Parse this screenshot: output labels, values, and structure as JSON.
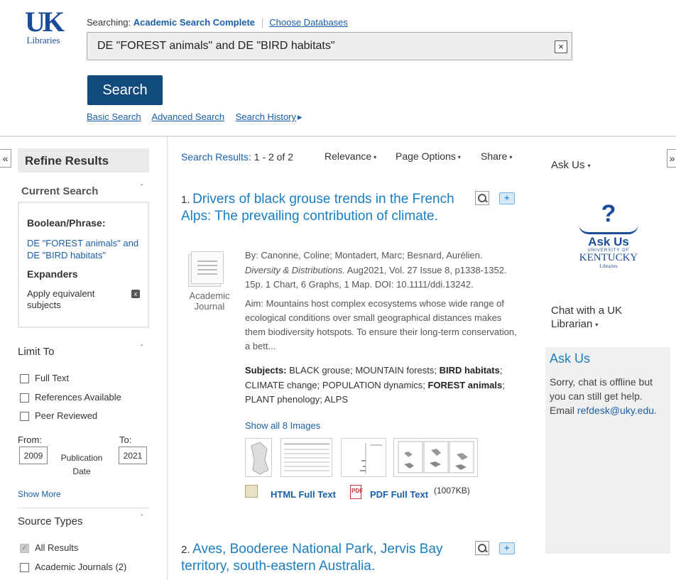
{
  "header": {
    "logo_uk": "UK",
    "logo_libraries": "Libraries",
    "searching_label": "Searching:",
    "database": "Academic Search Complete",
    "choose_databases": "Choose Databases",
    "search_value": "DE \"FOREST animals\" and DE \"BIRD habitats\"",
    "clear_label": "×",
    "search_button": "Search",
    "links": {
      "basic": "Basic Search",
      "advanced": "Advanced Search",
      "history": "Search History",
      "history_arrow": "▸"
    }
  },
  "left": {
    "collapse": "«",
    "refine_title": "Refine Results",
    "current_search_title": "Current Search",
    "caret": "ˇ",
    "boolean_title": "Boolean/Phrase:",
    "boolean_query": "DE \"FOREST animals\" and DE \"BIRD habitats\"",
    "expanders_title": "Expanders",
    "expander_item": "Apply equivalent subjects",
    "remove_x": "x",
    "limit_to_title": "Limit To",
    "limits": [
      "Full Text",
      "References Available",
      "Peer Reviewed"
    ],
    "from_label": "From:",
    "to_label": "To:",
    "from_value": "2009",
    "to_value": "2021",
    "publication_date": "Publication Date",
    "show_more": "Show More",
    "source_types_title": "Source Types",
    "source_all": "All Results",
    "source_academic": "Academic Journals (2)"
  },
  "center": {
    "results_label": "Search Results:",
    "results_count": "1 - 2 of 2",
    "toolbar": {
      "relevance": "Relevance",
      "page_options": "Page Options",
      "share": "Share",
      "caret": "▾"
    },
    "results": [
      {
        "num": "1.",
        "title": "Drivers of black grouse trends in the French Alps: The prevailing contribution of climate.",
        "pubtype": "Academic Journal",
        "authors": "By: Canonne, Coline; Montadert, Marc; Besnard, Aurélien.",
        "journal": "Diversity & Distributions.",
        "citation": "Aug2021, Vol. 27 Issue 8, p1338-1352. 15p. 1 Chart, 6 Graphs, 1 Map. DOI: 10.1111/ddi.13242.",
        "abstract": "Aim: Mountains host complex ecosystems whose wide range of ecological conditions over small geographical distances makes them biodiversity hotspots. To ensure their long-term conservation, a bett...",
        "subjects_label": "Subjects:",
        "subjects_part1": "BLACK grouse; MOUNTAIN forests;",
        "subjects_bold1": "BIRD habitats",
        "subjects_part2": "; CLIMATE change; POPULATION dynamics;",
        "subjects_bold2": "FOREST animals",
        "subjects_part3": "; PLANT phenology; ALPS",
        "show_images": "Show all 8 Images",
        "html_full_text": "HTML Full Text",
        "pdf_full_text": "PDF Full Text",
        "pdf_icon": "PDF",
        "pdf_size": "(1007KB)"
      },
      {
        "num": "2.",
        "title": "Aves, Booderee National Park, Jervis Bay territory, south-eastern Australia."
      }
    ]
  },
  "right": {
    "collapse": "»",
    "ask_us_menu": "Ask Us",
    "caret": "▾",
    "logo_q": "?",
    "logo_ask": "Ask Us",
    "logo_univ": "UNIVERSITY OF",
    "logo_ky": "KENTUCKY",
    "logo_libs": "Libraries",
    "chat_menu": "Chat with a UK Librarian",
    "chat_title": "Ask Us",
    "chat_msg": "Sorry, chat is offline but you can still get help. Email",
    "chat_email": "refdesk@uky.edu",
    "chat_end": "."
  }
}
